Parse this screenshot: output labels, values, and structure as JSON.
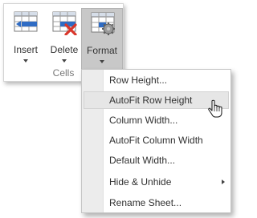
{
  "ribbon": {
    "buttons": [
      {
        "label": "Insert",
        "icon": "insert-cells-icon"
      },
      {
        "label": "Delete",
        "icon": "delete-cells-icon"
      },
      {
        "label": "Format",
        "icon": "format-cells-icon"
      }
    ],
    "group_label": "Cells"
  },
  "menu": {
    "items": [
      {
        "label": "Row Height..."
      },
      {
        "label": "AutoFit Row Height"
      },
      {
        "label": "Column Width..."
      },
      {
        "label": "AutoFit Column Width"
      },
      {
        "label": "Default Width..."
      },
      {
        "label": "Hide & Unhide"
      },
      {
        "label": "Rename Sheet..."
      }
    ]
  },
  "colors": {
    "accent_blue": "#2f6cc4",
    "delete_red": "#d9362b",
    "pressed_button": "#c8c8c8"
  }
}
